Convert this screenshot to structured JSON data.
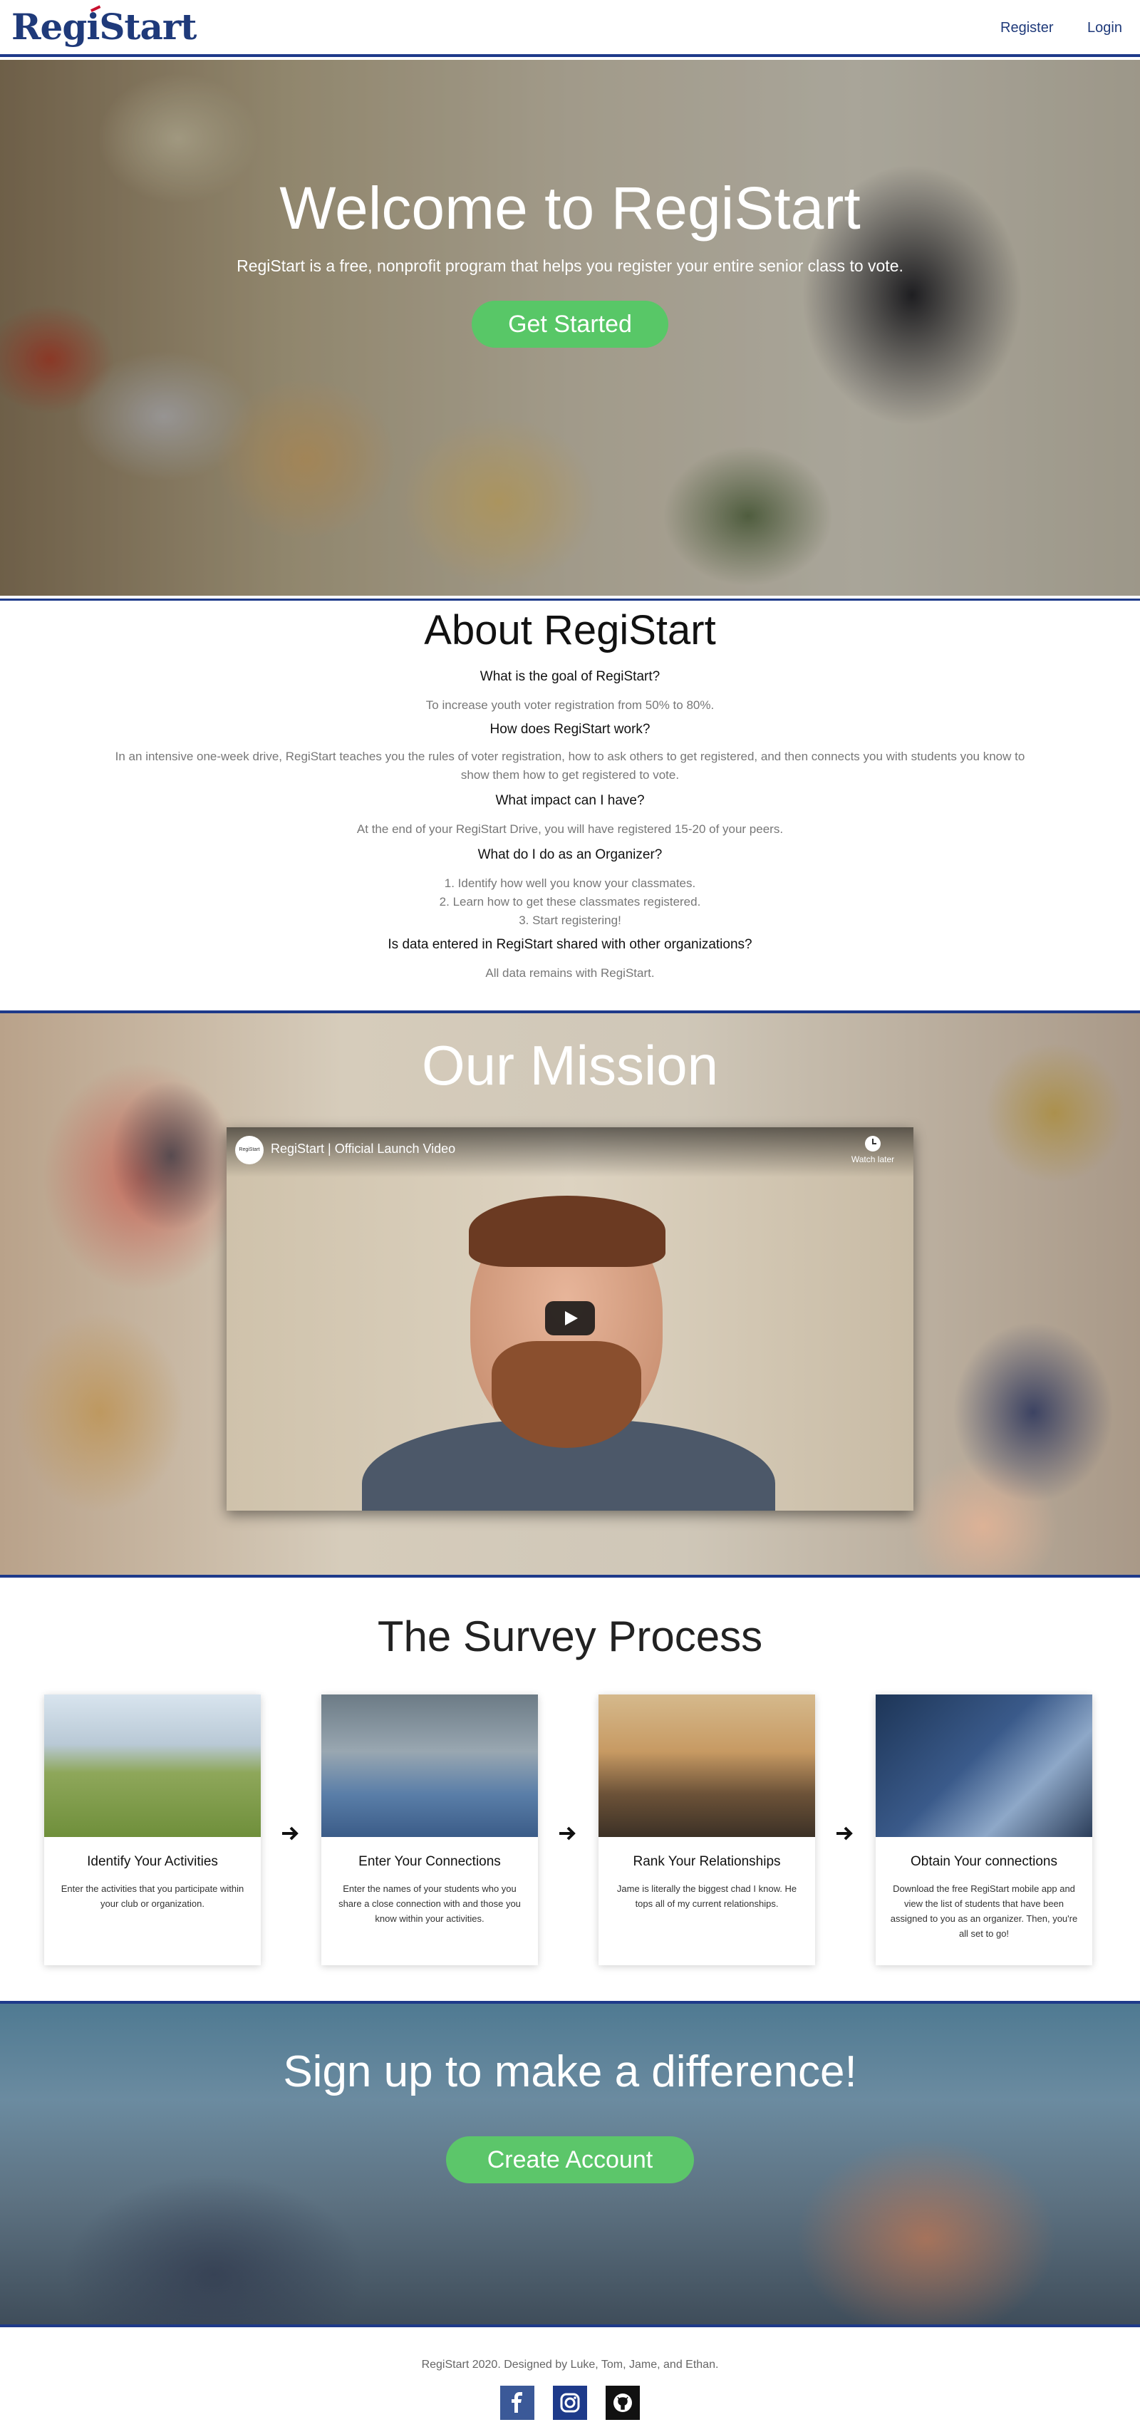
{
  "nav": {
    "logo": "RegiStart",
    "register": "Register",
    "login": "Login"
  },
  "hero": {
    "title": "Welcome to RegiStart",
    "subtitle": "RegiStart is a free, nonprofit program that helps you register your entire senior class to vote.",
    "button": "Get Started"
  },
  "about": {
    "title": "About RegiStart",
    "faq": [
      {
        "q": "What is the goal of RegiStart?",
        "a": "To increase youth voter registration from 50% to 80%."
      },
      {
        "q": "How does RegiStart work?",
        "a": "In an intensive one-week drive, RegiStart teaches you the rules of voter registration, how to ask others to get registered, and then connects you with students you know to show them how to get registered to vote."
      },
      {
        "q": "What impact can I have?",
        "a": "At the end of your RegiStart Drive, you will have registered 15-20 of your peers."
      },
      {
        "q": "What do I do as an Organizer?",
        "a_lines": [
          "1. Identify how well you know your classmates.",
          "2. Learn how to get these classmates registered.",
          "3. Start registering!"
        ]
      },
      {
        "q": "Is data entered in RegiStart shared with other organizations?",
        "a": "All data remains with RegiStart."
      }
    ]
  },
  "mission": {
    "title": "Our Mission",
    "video_title": "RegiStart | Official Launch Video",
    "channel": "RegiStart",
    "watch_later": "Watch later"
  },
  "survey": {
    "title": "The Survey Process",
    "steps": [
      {
        "title": "Identify Your Activities",
        "text": "Enter the activities that you participate within your club or organization."
      },
      {
        "title": "Enter Your Connections",
        "text": "Enter the names of your students who you share a close connection with and those you know within your activities."
      },
      {
        "title": "Rank Your Relationships",
        "text": "Jame is literally the biggest chad I know. He tops all of my current relationships."
      },
      {
        "title": "Obtain Your connections",
        "text": "Download the free RegiStart mobile app and view the list of students that have been assigned to you as an organizer. Then, you're all set to go!"
      }
    ]
  },
  "signup": {
    "title": "Sign up to make a difference!",
    "button": "Create Account"
  },
  "footer": {
    "text": "RegiStart 2020. Designed by Luke, Tom, Jame, and Ethan."
  },
  "colors": {
    "brand_navy": "#1e3a8a",
    "accent_green": "#5cc66a"
  },
  "icons": [
    "facebook-icon",
    "instagram-icon",
    "github-icon",
    "arrow-right-icon",
    "play-icon",
    "clock-icon"
  ]
}
